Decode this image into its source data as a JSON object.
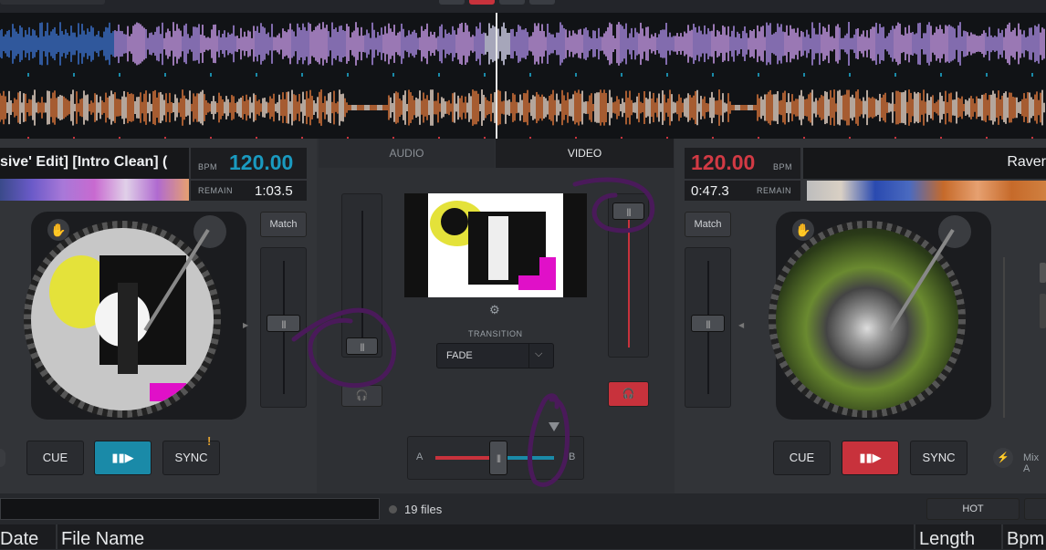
{
  "left_deck": {
    "title": "sive' Edit] [Intro Clean] (",
    "bpm_label": "BPM",
    "bpm": "120.00",
    "remain_label": "REMAIN",
    "remain": "1:03.5",
    "match_label": "Match",
    "cue_label": "CUE",
    "play_icon": "play-pause-icon",
    "sync_label": "SYNC",
    "accent_color": "#1a8aa8"
  },
  "right_deck": {
    "title": "Raver",
    "bpm_label": "BPM",
    "bpm": "120.00",
    "remain_label": "REMAIN",
    "remain": "0:47.3",
    "match_label": "Match",
    "cue_label": "CUE",
    "play_icon": "play-pause-icon",
    "sync_label": "SYNC",
    "mix_label": "Mix A",
    "accent_color": "#c8323c"
  },
  "mixer": {
    "tab_audio": "AUDIO",
    "tab_video": "VIDEO",
    "transition_label": "TRANSITION",
    "transition_value": "FADE",
    "crossfader_a": "A",
    "crossfader_b": "B"
  },
  "browser": {
    "file_count": "19 files",
    "hot_label": "HOT",
    "columns": [
      "Date",
      "File Name",
      "Length",
      "Bpm"
    ]
  }
}
